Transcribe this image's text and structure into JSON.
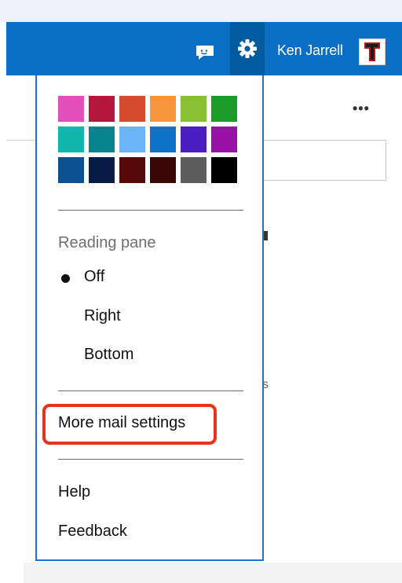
{
  "header": {
    "user_name": "Ken Jarrell",
    "accent_color": "#0a6fc4",
    "active_button_color": "#005a9e",
    "icons": [
      "feedback-icon",
      "gear-icon",
      "avatar"
    ]
  },
  "background": {
    "more_label": "•••"
  },
  "settings_menu": {
    "theme_colors": [
      "#e04fba",
      "#b5173d",
      "#d44b2e",
      "#f6953a",
      "#88c034",
      "#1d9b29",
      "#0fb7ad",
      "#08848f",
      "#6ab4f7",
      "#0e72c8",
      "#4a1ec2",
      "#9812a8",
      "#0b5091",
      "#081b44",
      "#550a0a",
      "#3a0606",
      "#5c5c5c",
      "#000000"
    ],
    "reading_pane": {
      "label": "Reading pane",
      "options": [
        {
          "label": "Off",
          "selected": true
        },
        {
          "label": "Right",
          "selected": false
        },
        {
          "label": "Bottom",
          "selected": false
        }
      ]
    },
    "more_mail_settings": "More mail settings",
    "highlight_color": "#e8321f",
    "help": "Help",
    "feedback": "Feedback"
  }
}
